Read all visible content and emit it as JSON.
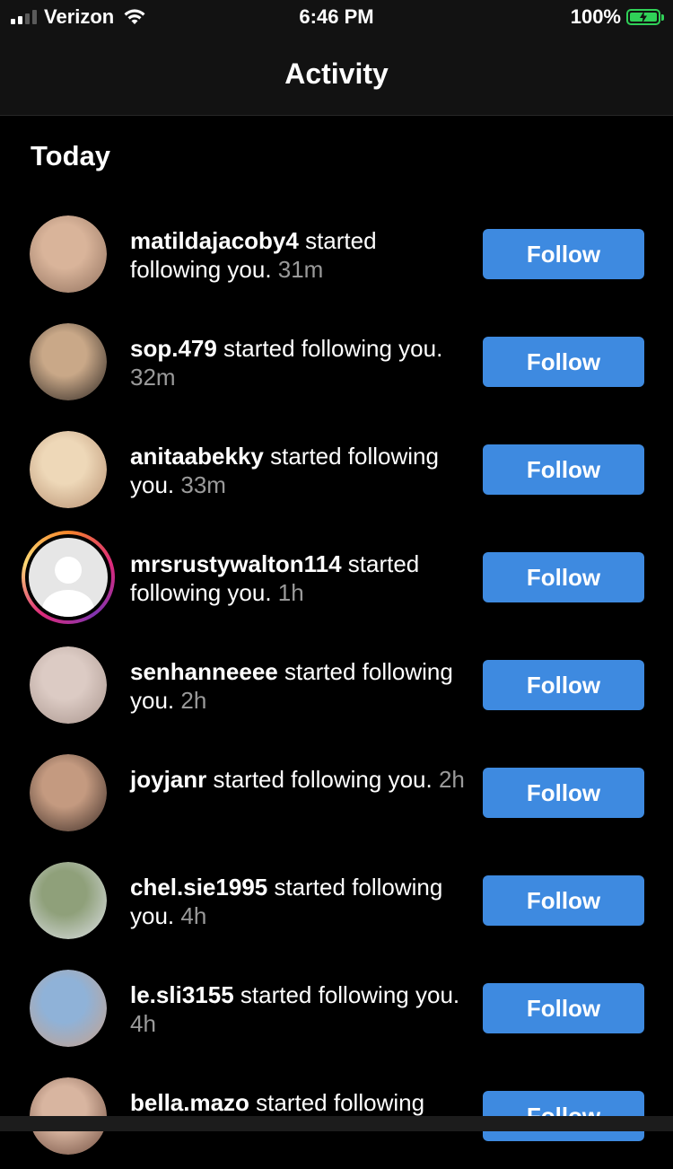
{
  "status_bar": {
    "carrier": "Verizon",
    "time": "6:46 PM",
    "battery": "100%"
  },
  "header": {
    "title": "Activity"
  },
  "section": {
    "title": "Today"
  },
  "activities": [
    {
      "username": "matildajacoby4",
      "action": " started following you. ",
      "time": "31m",
      "follow_label": "Follow",
      "avatar_colors": [
        "#d9b49a",
        "#8f6f5c"
      ]
    },
    {
      "username": "sop.479",
      "action": " started following you. ",
      "time": "32m",
      "follow_label": "Follow",
      "avatar_colors": [
        "#c9a888",
        "#2b2420"
      ]
    },
    {
      "username": "anitaabekky",
      "action": " started following you. ",
      "time": "33m",
      "follow_label": "Follow",
      "avatar_colors": [
        "#eed8b8",
        "#b58d6e"
      ]
    },
    {
      "username": "mrsrustywalton114",
      "action": " started following you. ",
      "time": "1h",
      "follow_label": "Follow",
      "avatar_colors": [
        "#e6e6e6",
        "#ffffff"
      ],
      "has_story_ring": true
    },
    {
      "username": "senhanneeee",
      "action": " started following you. ",
      "time": "2h",
      "follow_label": "Follow",
      "avatar_colors": [
        "#dccbc4",
        "#a8948c"
      ]
    },
    {
      "username": "joyjanr",
      "action": " started following you. ",
      "time": "2h",
      "follow_label": "Follow",
      "avatar_colors": [
        "#c49a80",
        "#3b2b25"
      ]
    },
    {
      "username": "chel.sie1995",
      "action": " started following you. ",
      "time": "4h",
      "follow_label": "Follow",
      "avatar_colors": [
        "#8fa07a",
        "#dfe2e8"
      ]
    },
    {
      "username": "le.sli3155",
      "action": " started following you. ",
      "time": "4h",
      "follow_label": "Follow",
      "avatar_colors": [
        "#8fb2d8",
        "#c8a18a"
      ]
    },
    {
      "username": "bella.mazo",
      "action": " started following",
      "time": "",
      "follow_label": "Follow",
      "avatar_colors": [
        "#d8b5a0",
        "#6d4a3c"
      ]
    }
  ],
  "colors": {
    "background": "#000000",
    "header": "#121212",
    "follow_button": "#3e8ae0",
    "time_text": "#9a9a9a",
    "battery": "#30d158"
  }
}
